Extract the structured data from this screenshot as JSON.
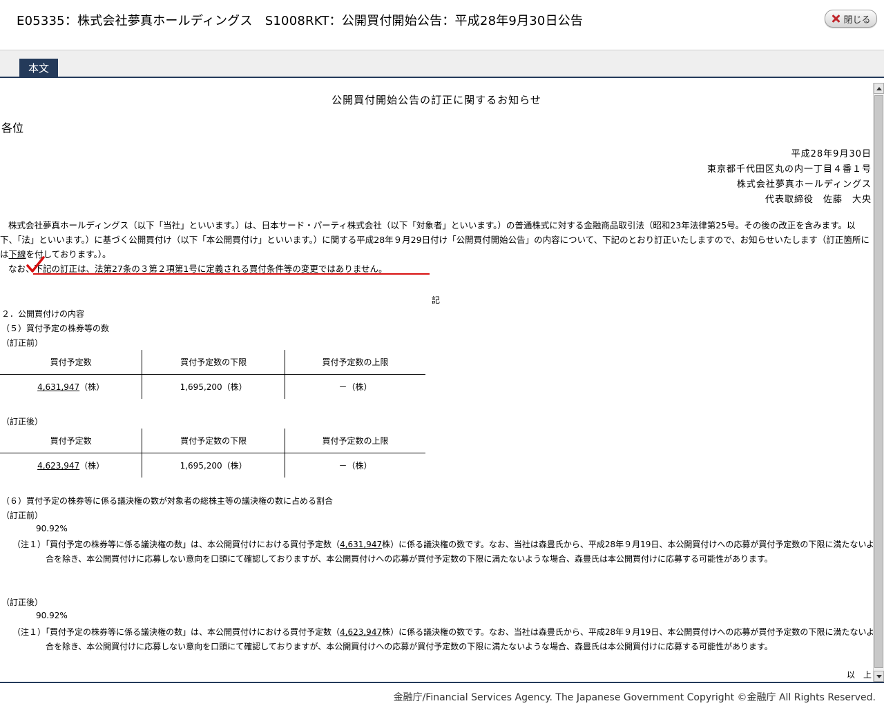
{
  "header": {
    "title": "E05335：株式会社夢真ホールディングス　S1008RKT：公開買付開始公告：平成28年9月30日公告",
    "close_label": "閉じる"
  },
  "tabs": [
    {
      "label": "本文"
    }
  ],
  "document": {
    "title": "公開買付開始公告の訂正に関するお知らせ",
    "addressee": "各位",
    "date": "平成28年9月30日",
    "address": "東京都千代田区丸の内一丁目４番１号",
    "company": "株式会社夢真ホールディングス",
    "representative": "代表取締役　佐藤　大央",
    "para1": "株式会社夢真ホールディングス（以下「当社」といいます。）は、日本サード・パーティ株式会社（以下「対象者」といいます。）の普通株式に対する金融商品取引法（昭和23年法律第25号。その後の改正を含みます。以下、「法」といいます。）に基づく公開買付け（以下「本公開買付け」といいます。）に関する平成28年９月29日付け「公開買付開始公告」の内容について、下記のとおり訂正いたしますので、お知らせいたします（訂正箇所には",
    "para1_underlined": "下線",
    "para1_end": "を付しております。）。",
    "para2_lead": "なお、",
    "para2_body": "下記の訂正は、法第27条の３第２項第1号に定義される買付条件等の変更ではありません。",
    "ki": "記",
    "section_heading": "２．公開買付けの内容",
    "subsection5": "（５）買付予定の株券等の数",
    "before_label": "（訂正前）",
    "after_label": "（訂正後）",
    "table_headers": [
      "買付予定数",
      "買付予定数の下限",
      "買付予定数の上限"
    ],
    "table_before": {
      "planned": "4,631,947",
      "planned_unit": "（株）",
      "lower": "1,695,200（株）",
      "upper": "－（株）"
    },
    "table_after": {
      "planned": "4,623,947",
      "planned_unit": "（株）",
      "lower": "1,695,200（株）",
      "upper": "－（株）"
    },
    "subsection6": "（６）買付予定の株券等に係る議決権の数が対象者の総株主等の議決権の数に占める割合",
    "ratio_before": "90.92%",
    "ratio_after": "90.92%",
    "note_prefix": "（注１）「買付予定の株券等に係る議決権の数」は、本公開買付けにおける買付予定数（",
    "note_before_number": "4,631,947",
    "note_after_number": "4,623,947",
    "note_suffix": "株）に係る議決権の数です。なお、当社は森豊氏から、平成28年９月19日、本公開買付けへの応募が買付予定数の下限に満たないような場合を除き、本公開買付けに応募しない意向を口頭にて確認しておりますが、本公開買付けへの応募が買付予定数の下限に満たないような場合、森豊氏は本公開買付けに応募する可能性があります。",
    "closing": "以　上"
  },
  "footer": {
    "copyright": "金融庁/Financial Services Agency. The Japanese Government Copyright ©金融庁 All Rights Reserved."
  },
  "colors": {
    "nav_bar": "#243a5a",
    "annotation_red": "#d81010"
  }
}
